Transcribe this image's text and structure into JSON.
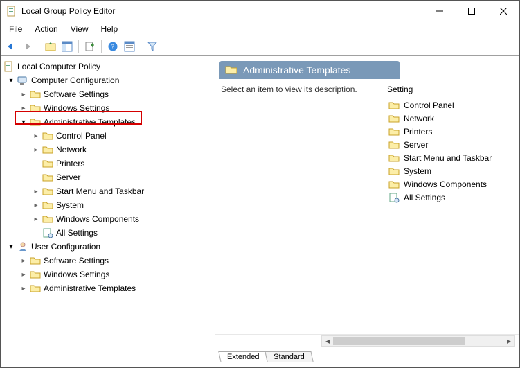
{
  "window": {
    "title": "Local Group Policy Editor"
  },
  "menu": {
    "file": "File",
    "action": "Action",
    "view": "View",
    "help": "Help"
  },
  "tree": {
    "root": "Local Computer Policy",
    "computer_config": "Computer Configuration",
    "cc_software": "Software Settings",
    "cc_windows": "Windows Settings",
    "cc_admin": "Administrative Templates",
    "cc_admin_children": {
      "control_panel": "Control Panel",
      "network": "Network",
      "printers": "Printers",
      "server": "Server",
      "start_menu": "Start Menu and Taskbar",
      "system": "System",
      "windows_components": "Windows Components",
      "all_settings": "All Settings"
    },
    "user_config": "User Configuration",
    "uc_software": "Software Settings",
    "uc_windows": "Windows Settings",
    "uc_admin": "Administrative Templates"
  },
  "detail": {
    "header": "Administrative Templates",
    "description": "Select an item to view its description.",
    "setting_header": "Setting",
    "items": {
      "control_panel": "Control Panel",
      "network": "Network",
      "printers": "Printers",
      "server": "Server",
      "start_menu": "Start Menu and Taskbar",
      "system": "System",
      "windows_components": "Windows Components",
      "all_settings": "All Settings"
    }
  },
  "tabs": {
    "extended": "Extended",
    "standard": "Standard"
  }
}
